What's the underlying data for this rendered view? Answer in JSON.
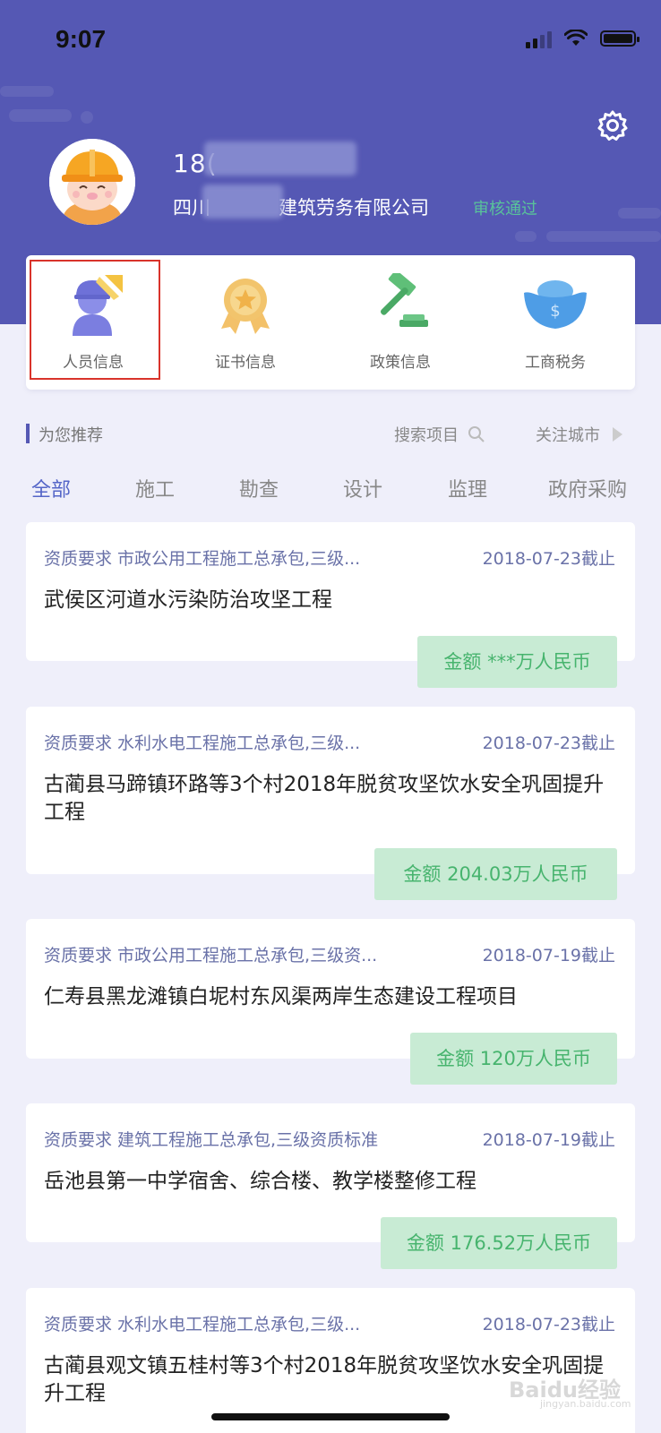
{
  "status_bar": {
    "time": "9:07"
  },
  "profile": {
    "phone_visible": "18(",
    "company_prefix": "四川",
    "company_suffix": "建筑劳务有限公司",
    "audit_status": "审核通过"
  },
  "menu": [
    {
      "label": "人员信息",
      "icon": "worker-icon"
    },
    {
      "label": "证书信息",
      "icon": "medal-icon"
    },
    {
      "label": "政策信息",
      "icon": "gavel-icon"
    },
    {
      "label": "工商税务",
      "icon": "ingot-icon"
    }
  ],
  "recommend": {
    "title": "为您推荐",
    "search_label": "搜索项目",
    "follow_label": "关注城市"
  },
  "tabs": [
    "全部",
    "施工",
    "勘查",
    "设计",
    "监理",
    "政府采购"
  ],
  "active_tab": "全部",
  "projects": [
    {
      "req": "资质要求 市政公用工程施工总承包,三级...",
      "deadline": "2018-07-23截止",
      "title": "武侯区河道水污染防治攻坚工程",
      "amount": "金额 ***万人民币"
    },
    {
      "req": "资质要求 水利水电工程施工总承包,三级...",
      "deadline": "2018-07-23截止",
      "title": "古蔺县马蹄镇环路等3个村2018年脱贫攻坚饮水安全巩固提升工程",
      "amount": "金额 204.03万人民币"
    },
    {
      "req": "资质要求 市政公用工程施工总承包,三级资...",
      "deadline": "2018-07-19截止",
      "title": "仁寿县黑龙滩镇白坭村东风渠两岸生态建设工程项目",
      "amount": "金额 120万人民币"
    },
    {
      "req": "资质要求 建筑工程施工总承包,三级资质标准",
      "deadline": "2018-07-19截止",
      "title": "岳池县第一中学宿舍、综合楼、教学楼整修工程",
      "amount": "金额 176.52万人民币"
    },
    {
      "req": "资质要求 水利水电工程施工总承包,三级...",
      "deadline": "2018-07-23截止",
      "title": "古蔺县观文镇五桂村等3个村2018年脱贫攻坚饮水安全巩固提升工程",
      "amount": ""
    }
  ],
  "watermark": {
    "main": "Baidu经验",
    "sub": "jingyan.baidu.com"
  },
  "colors": {
    "header": "#5558b4",
    "accent": "#5566c8",
    "success": "#59c39a",
    "amount_bg": "#c8ebd4",
    "amount_text": "#47b46e"
  }
}
